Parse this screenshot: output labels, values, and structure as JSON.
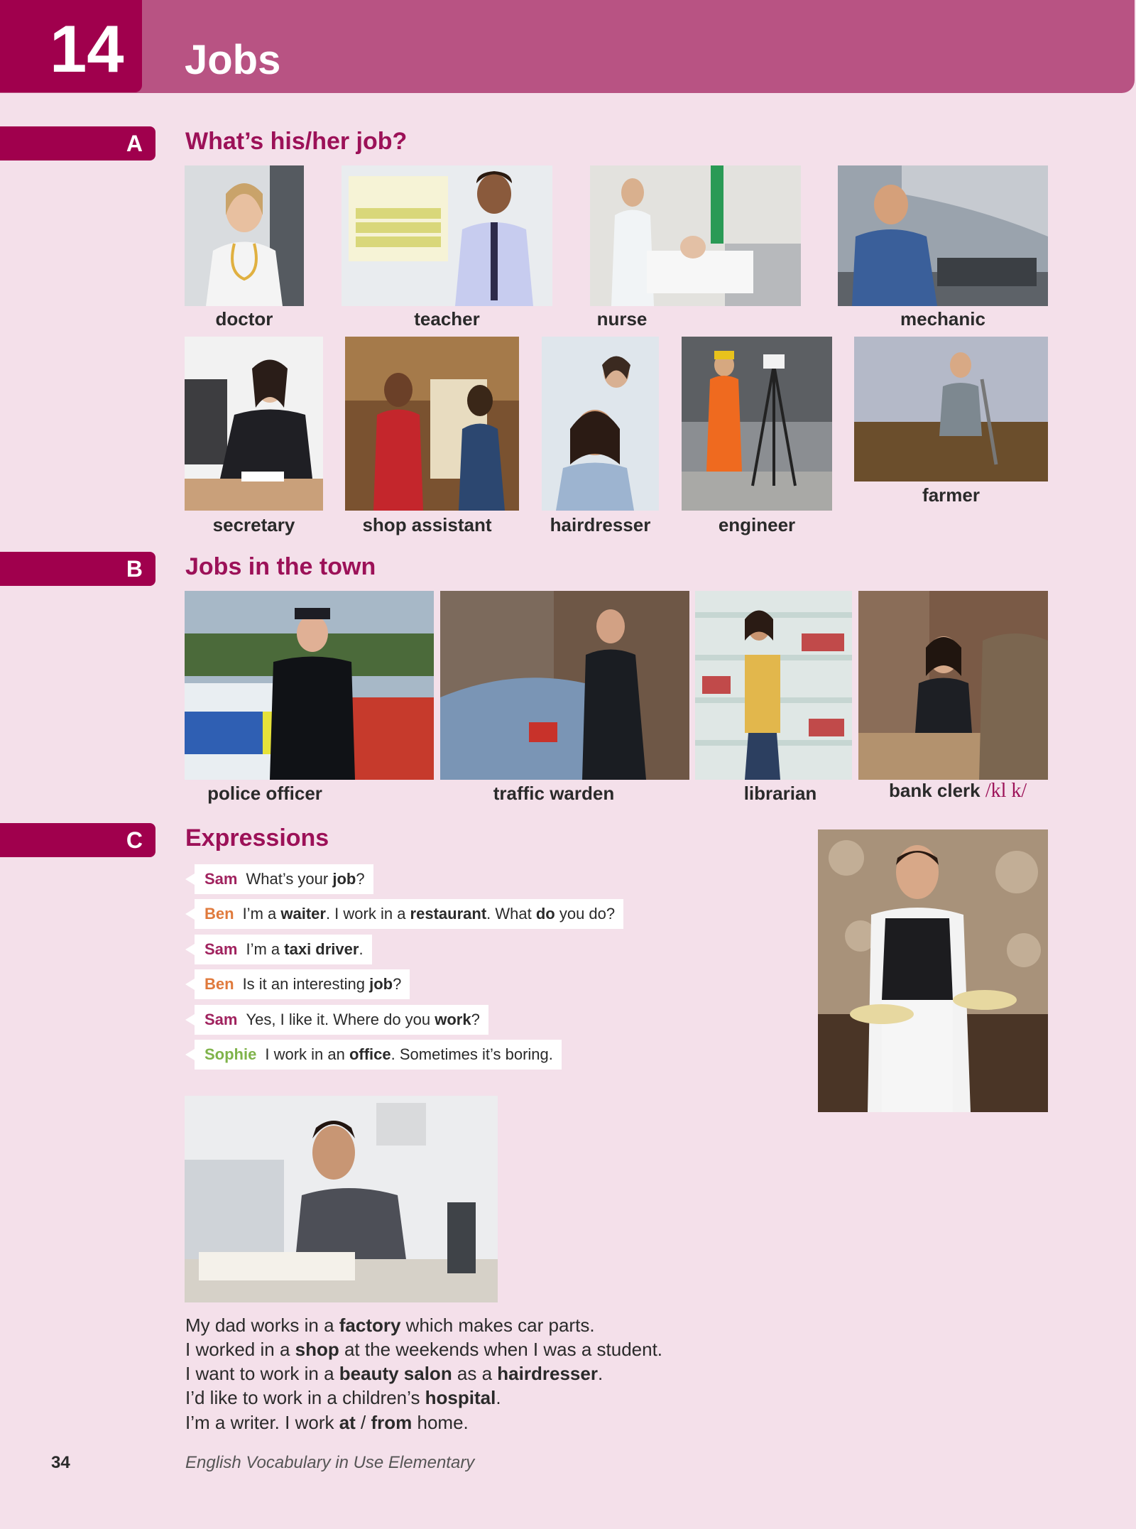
{
  "header": {
    "unit_number": "14",
    "unit_title": "Jobs"
  },
  "colors": {
    "accent": "#a0004d",
    "header_band": "#b85383",
    "page_bg": "#f4e0ea",
    "heading": "#9c1158"
  },
  "sections": {
    "a": {
      "letter": "A",
      "title": "What’s his/her job?",
      "jobs": [
        "doctor",
        "teacher",
        "nurse",
        "mechanic",
        "secretary",
        "shop assistant",
        "hairdresser",
        "engineer",
        "farmer"
      ]
    },
    "b": {
      "letter": "B",
      "title": "Jobs in the town",
      "jobs": [
        "police officer",
        "traffic warden",
        "librarian",
        "bank clerk"
      ],
      "bank_clerk_ipa": "/kl     k/"
    },
    "c": {
      "letter": "C",
      "title": "Expressions",
      "dialogue": [
        {
          "speaker": "Sam",
          "parts": [
            "What’s your ",
            "job",
            "?"
          ]
        },
        {
          "speaker": "Ben",
          "parts": [
            "I’m a ",
            "waiter",
            ". I work in a ",
            "restaurant",
            ". What ",
            "do",
            " you do?"
          ]
        },
        {
          "speaker": "Sam",
          "parts": [
            "I’m a ",
            "taxi driver",
            "."
          ]
        },
        {
          "speaker": "Ben",
          "parts": [
            "Is it an interesting ",
            "job",
            "?"
          ]
        },
        {
          "speaker": "Sam",
          "parts": [
            "Yes, I like it. Where do you ",
            "work",
            "?"
          ]
        },
        {
          "speaker": "Sophie",
          "parts": [
            "I work in an ",
            "office",
            ". Sometimes it’s boring."
          ]
        }
      ],
      "sentences": [
        [
          "My dad works in a ",
          "factory",
          " which makes car parts."
        ],
        [
          "I worked in a ",
          "shop",
          " at the weekends when I was a student."
        ],
        [
          "I want to work in a ",
          "beauty salon",
          " as a ",
          "hairdresser",
          "."
        ],
        [
          "I’d like to work in a children’s ",
          "hospital",
          "."
        ],
        [
          "I’m a writer. I work ",
          "at",
          " / ",
          "from",
          " home."
        ]
      ]
    }
  },
  "footer": {
    "page_number": "34",
    "book_title": "English Vocabulary in Use Elementary"
  }
}
